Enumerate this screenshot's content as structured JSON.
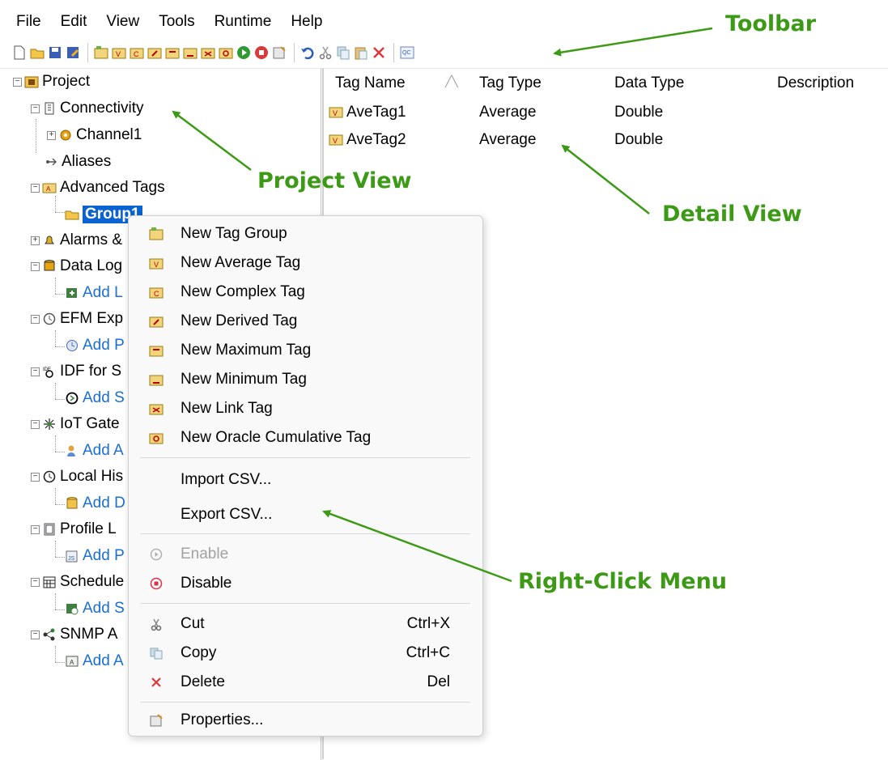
{
  "menubar": {
    "items": [
      "File",
      "Edit",
      "View",
      "Tools",
      "Runtime",
      "Help"
    ]
  },
  "toolbar": {
    "buttons": [
      "new-project",
      "open-project",
      "save",
      "save-as",
      "new-tag-group",
      "new-average-tag",
      "new-complex-tag",
      "new-derived-tag",
      "new-maximum-tag",
      "new-minimum-tag",
      "new-link-tag",
      "new-oracle-cumulative-tag",
      "enable",
      "disable",
      "properties",
      "undo",
      "cut",
      "copy",
      "paste",
      "delete",
      "quick-client"
    ]
  },
  "tree": {
    "project": "Project",
    "connectivity": "Connectivity",
    "channel1": "Channel1",
    "aliases": "Aliases",
    "advanced_tags": "Advanced Tags",
    "group1": "Group1",
    "alarms": "Alarms &",
    "data_logger": "Data Log",
    "data_logger_add": "Add L",
    "efm": "EFM Exp",
    "efm_add": "Add P",
    "idf": "IDF for S",
    "idf_add": "Add S",
    "iot": "IoT Gate",
    "iot_add": "Add A",
    "local_historian": "Local His",
    "local_historian_add": "Add D",
    "profile": "Profile L",
    "profile_add": "Add P",
    "scheduler": "Schedule",
    "scheduler_add": "Add S",
    "snmp": "SNMP A",
    "snmp_add": "Add A"
  },
  "detail": {
    "columns": [
      "Tag Name",
      "Tag Type",
      "Data Type",
      "Description"
    ],
    "rows": [
      {
        "name": "AveTag1",
        "type": "Average",
        "data_type": "Double",
        "description": ""
      },
      {
        "name": "AveTag2",
        "type": "Average",
        "data_type": "Double",
        "description": ""
      }
    ]
  },
  "context_menu": {
    "new_tag_group": "New Tag Group",
    "new_average_tag": "New Average Tag",
    "new_complex_tag": "New Complex Tag",
    "new_derived_tag": "New Derived Tag",
    "new_maximum_tag": "New Maximum Tag",
    "new_minimum_tag": "New Minimum Tag",
    "new_link_tag": "New Link Tag",
    "new_oracle_cumulative_tag": "New Oracle Cumulative Tag",
    "import_csv": "Import CSV...",
    "export_csv": "Export CSV...",
    "enable": "Enable",
    "disable": "Disable",
    "cut": "Cut",
    "cut_shortcut": "Ctrl+X",
    "copy": "Copy",
    "copy_shortcut": "Ctrl+C",
    "delete": "Delete",
    "delete_shortcut": "Del",
    "properties": "Properties..."
  },
  "annotations": {
    "toolbar": "Toolbar",
    "project_view": "Project View",
    "detail_view": "Detail View",
    "right_click_menu": "Right-Click Menu"
  },
  "colors": {
    "annotation_green": "#3c9a16",
    "selection_blue": "#0a63d0",
    "link_blue": "#1a6fd6"
  }
}
